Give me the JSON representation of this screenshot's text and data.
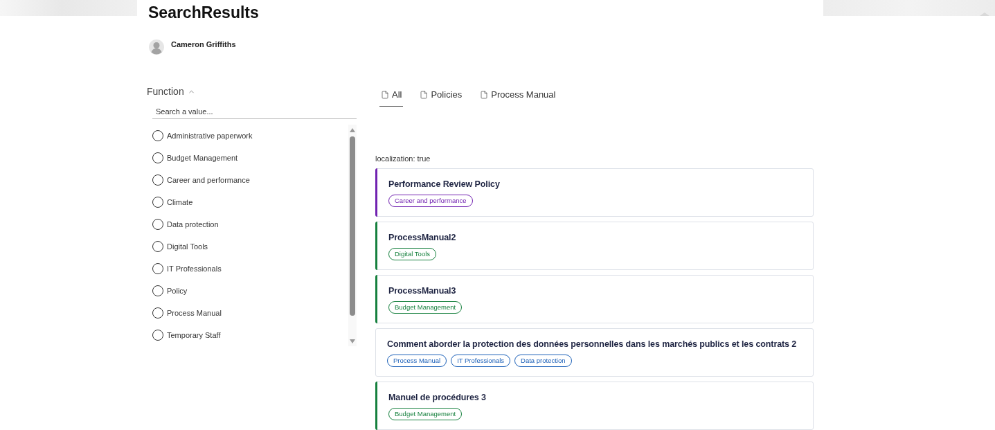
{
  "header": {
    "title": "SearchResults",
    "user": {
      "name": "Cameron Griffiths"
    }
  },
  "filter": {
    "label": "Function",
    "expanded": true,
    "search": {
      "placeholder": "Search a value..."
    },
    "options": [
      {
        "label": "Administrative paperwork",
        "selected": false
      },
      {
        "label": "Budget Management",
        "selected": false
      },
      {
        "label": "Career and performance",
        "selected": false
      },
      {
        "label": "Climate",
        "selected": false
      },
      {
        "label": "Data protection",
        "selected": false
      },
      {
        "label": "Digital Tools",
        "selected": false
      },
      {
        "label": "IT Professionals",
        "selected": false
      },
      {
        "label": "Policy",
        "selected": false
      },
      {
        "label": "Process Manual",
        "selected": false
      },
      {
        "label": "Temporary Staff",
        "selected": false
      }
    ]
  },
  "tabs": [
    {
      "label": "All",
      "selected": true
    },
    {
      "label": "Policies",
      "selected": false
    },
    {
      "label": "Process Manual",
      "selected": false
    }
  ],
  "results": {
    "note": "localization: true",
    "items": [
      {
        "title": "Performance Review Policy",
        "color": "#7021b0",
        "tags": [
          {
            "label": "Career and performance",
            "color": "#7021b0"
          }
        ]
      },
      {
        "title": "ProcessManual2",
        "color": "#15803d",
        "tags": [
          {
            "label": "Digital Tools",
            "color": "#15803d"
          }
        ]
      },
      {
        "title": "ProcessManual3",
        "color": "#15803d",
        "tags": [
          {
            "label": "Budget Management",
            "color": "#15803d"
          }
        ]
      },
      {
        "title": "Comment aborder la protection des données personnelles dans les marchés publics et les contrats 2",
        "tags": [
          {
            "label": "Process Manual",
            "color": "#1a5fb8"
          },
          {
            "label": "IT Professionals",
            "color": "#1a5fb8"
          },
          {
            "label": "Data protection",
            "color": "#1a5fb8"
          }
        ]
      },
      {
        "title": "Manuel de procédures 3",
        "color": "#15803d",
        "tags": [
          {
            "label": "Budget Management",
            "color": "#15803d"
          }
        ]
      }
    ]
  }
}
